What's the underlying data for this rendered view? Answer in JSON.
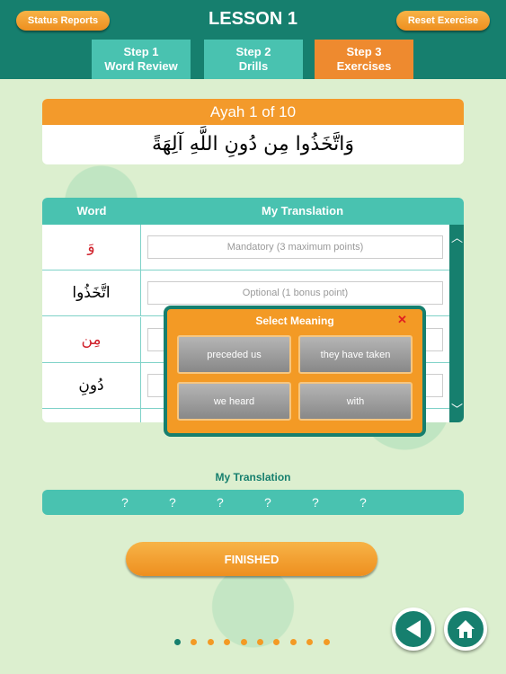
{
  "header": {
    "title": "LESSON 1",
    "status_reports": "Status Reports",
    "reset_exercise": "Reset Exercise"
  },
  "tabs": [
    {
      "line1": "Step 1",
      "line2": "Word Review"
    },
    {
      "line1": "Step 2",
      "line2": "Drills"
    },
    {
      "line1": "Step 3",
      "line2": "Exercises",
      "active": true
    }
  ],
  "ayah": {
    "counter": "Ayah 1 of 10",
    "text": "وَاتَّخَذُوا مِن دُونِ اللَّهِ آلِهَةً"
  },
  "table": {
    "col_word": "Word",
    "col_translation": "My Translation",
    "rows": [
      {
        "word": "وَ",
        "color": "#d0202a",
        "placeholder": "Mandatory (3 maximum points)"
      },
      {
        "word": "اتَّخَذُوا",
        "color": "#000000",
        "placeholder": "Optional (1 bonus point)"
      },
      {
        "word": "مِن",
        "color": "#d0202a",
        "placeholder": ""
      },
      {
        "word": "دُونِ",
        "color": "#000000",
        "placeholder": ""
      }
    ]
  },
  "popup": {
    "title": "Select Meaning",
    "close": "✕",
    "options": [
      "preceded us",
      "they have taken",
      "we heard",
      "with"
    ]
  },
  "translation": {
    "label": "My Translation",
    "slots": [
      "?",
      "?",
      "?",
      "?",
      "?",
      "?"
    ]
  },
  "finished": "FINISHED",
  "pager": {
    "total": 10,
    "current": 1
  },
  "colors": {
    "teal": "#167f6e",
    "light_teal": "#49c2b0",
    "orange": "#f39a25"
  }
}
